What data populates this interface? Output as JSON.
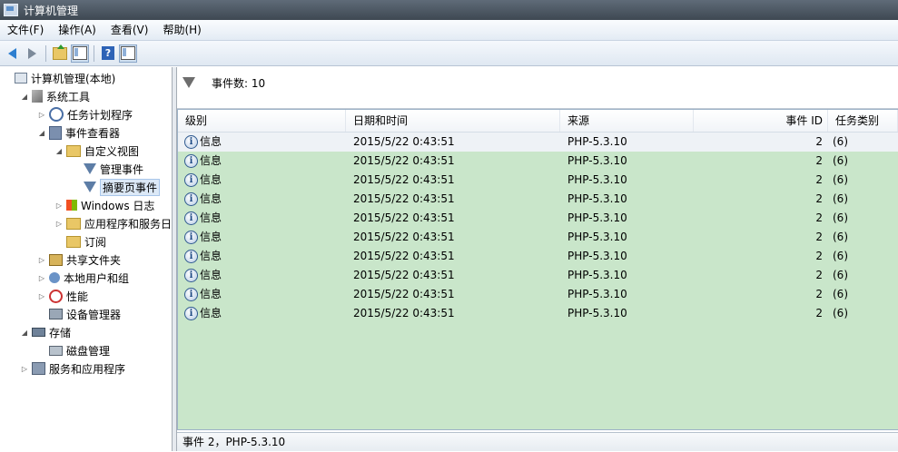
{
  "window": {
    "title": "计算机管理"
  },
  "menu": [
    "文件(F)",
    "操作(A)",
    "查看(V)",
    "帮助(H)"
  ],
  "toolbar": {
    "help_label": "?"
  },
  "tree": [
    {
      "label": "计算机管理(本地)",
      "level": 0,
      "expander": "",
      "icon": "computer-icon"
    },
    {
      "label": "系统工具",
      "level": 1,
      "expander": "◢",
      "icon": "tools-icon"
    },
    {
      "label": "任务计划程序",
      "level": 2,
      "expander": "▷",
      "icon": "clock-icon"
    },
    {
      "label": "事件查看器",
      "level": 2,
      "expander": "◢",
      "icon": "event-viewer-icon"
    },
    {
      "label": "自定义视图",
      "level": 3,
      "expander": "◢",
      "icon": "folder-icon"
    },
    {
      "label": "管理事件",
      "level": 4,
      "expander": "",
      "icon": "filter-icon"
    },
    {
      "label": "摘要页事件",
      "level": 4,
      "expander": "",
      "icon": "filter-icon",
      "selected": true
    },
    {
      "label": "Windows 日志",
      "level": 3,
      "expander": "▷",
      "icon": "windows-log-icon"
    },
    {
      "label": "应用程序和服务日志",
      "level": 3,
      "expander": "▷",
      "icon": "folder-icon"
    },
    {
      "label": "订阅",
      "level": 3,
      "expander": "",
      "icon": "folder-icon"
    },
    {
      "label": "共享文件夹",
      "level": 2,
      "expander": "▷",
      "icon": "shared-folder-icon"
    },
    {
      "label": "本地用户和组",
      "level": 2,
      "expander": "▷",
      "icon": "users-icon"
    },
    {
      "label": "性能",
      "level": 2,
      "expander": "▷",
      "icon": "performance-icon"
    },
    {
      "label": "设备管理器",
      "level": 2,
      "expander": "",
      "icon": "device-manager-icon"
    },
    {
      "label": "存储",
      "level": 1,
      "expander": "◢",
      "icon": "storage-icon"
    },
    {
      "label": "磁盘管理",
      "level": 2,
      "expander": "",
      "icon": "disk-icon"
    },
    {
      "label": "服务和应用程序",
      "level": 1,
      "expander": "▷",
      "icon": "services-icon"
    }
  ],
  "summary": {
    "event_count": "事件数: 10"
  },
  "grid": {
    "columns": [
      "级别",
      "日期和时间",
      "来源",
      "事件 ID",
      "任务类别"
    ],
    "rows": [
      {
        "level": "信息",
        "datetime": "2015/5/22 0:43:51",
        "source": "PHP-5.3.10",
        "event_id": "2",
        "category": "(6)"
      },
      {
        "level": "信息",
        "datetime": "2015/5/22 0:43:51",
        "source": "PHP-5.3.10",
        "event_id": "2",
        "category": "(6)"
      },
      {
        "level": "信息",
        "datetime": "2015/5/22 0:43:51",
        "source": "PHP-5.3.10",
        "event_id": "2",
        "category": "(6)"
      },
      {
        "level": "信息",
        "datetime": "2015/5/22 0:43:51",
        "source": "PHP-5.3.10",
        "event_id": "2",
        "category": "(6)"
      },
      {
        "level": "信息",
        "datetime": "2015/5/22 0:43:51",
        "source": "PHP-5.3.10",
        "event_id": "2",
        "category": "(6)"
      },
      {
        "level": "信息",
        "datetime": "2015/5/22 0:43:51",
        "source": "PHP-5.3.10",
        "event_id": "2",
        "category": "(6)"
      },
      {
        "level": "信息",
        "datetime": "2015/5/22 0:43:51",
        "source": "PHP-5.3.10",
        "event_id": "2",
        "category": "(6)"
      },
      {
        "level": "信息",
        "datetime": "2015/5/22 0:43:51",
        "source": "PHP-5.3.10",
        "event_id": "2",
        "category": "(6)"
      },
      {
        "level": "信息",
        "datetime": "2015/5/22 0:43:51",
        "source": "PHP-5.3.10",
        "event_id": "2",
        "category": "(6)"
      },
      {
        "level": "信息",
        "datetime": "2015/5/22 0:43:51",
        "source": "PHP-5.3.10",
        "event_id": "2",
        "category": "(6)"
      }
    ]
  },
  "status": {
    "text": "事件 2，PHP-5.3.10"
  }
}
